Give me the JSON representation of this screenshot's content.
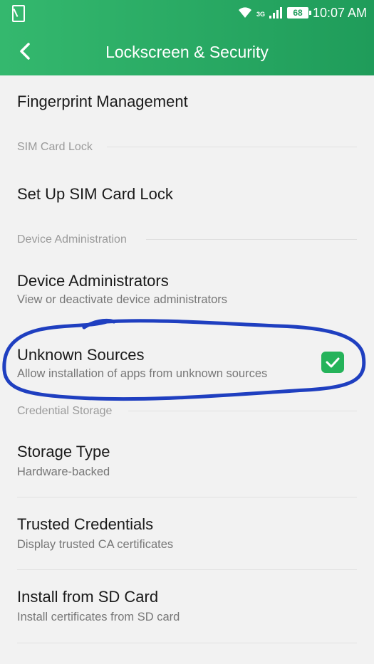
{
  "status_bar": {
    "time": "10:07 AM",
    "battery": "68",
    "network": "3G"
  },
  "header": {
    "title": "Lockscreen & Security"
  },
  "items": {
    "fingerprint": {
      "title": "Fingerprint Management"
    },
    "sim_section": "SIM Card Lock",
    "sim_lock": {
      "title": "Set Up SIM Card Lock"
    },
    "device_section": "Device Administration",
    "device_admins": {
      "title": "Device Administrators",
      "subtitle": "View or deactivate device administrators"
    },
    "unknown_sources": {
      "title": "Unknown Sources",
      "subtitle": "Allow installation of apps from unknown sources",
      "checked": true
    },
    "credential_section": "Credential Storage",
    "storage_type": {
      "title": "Storage Type",
      "subtitle": "Hardware-backed"
    },
    "trusted_credentials": {
      "title": "Trusted Credentials",
      "subtitle": "Display trusted CA certificates"
    },
    "install_sd": {
      "title": "Install from SD Card",
      "subtitle": "Install certificates from SD card"
    }
  },
  "colors": {
    "accent": "#25b35a",
    "header": "#2aa864",
    "annotation": "#1f3fc0"
  }
}
